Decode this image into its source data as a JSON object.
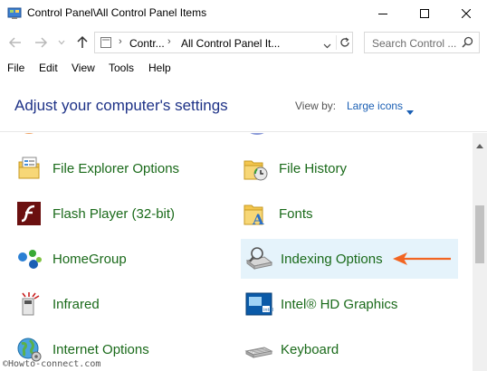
{
  "window": {
    "title": "Control Panel\\All Control Panel Items"
  },
  "address": {
    "crumbs": [
      "Contr...",
      "All Control Panel It..."
    ],
    "search_placeholder": "Search Control ..."
  },
  "menu": [
    "File",
    "Edit",
    "View",
    "Tools",
    "Help"
  ],
  "header": {
    "heading": "Adjust your computer's settings",
    "view_by_label": "View by:",
    "view_by_value": "Large icons"
  },
  "items": [
    {
      "label": "File Explorer Options",
      "icon": "file-explorer-options-icon"
    },
    {
      "label": "File History",
      "icon": "file-history-icon"
    },
    {
      "label": "Flash Player (32-bit)",
      "icon": "flash-player-icon"
    },
    {
      "label": "Fonts",
      "icon": "fonts-icon"
    },
    {
      "label": "HomeGroup",
      "icon": "homegroup-icon"
    },
    {
      "label": "Indexing Options",
      "icon": "indexing-options-icon",
      "selected": true
    },
    {
      "label": "Infrared",
      "icon": "infrared-icon"
    },
    {
      "label": "Intel® HD Graphics",
      "icon": "intel-graphics-icon"
    },
    {
      "label": "Internet Options",
      "icon": "internet-options-icon"
    },
    {
      "label": "Keyboard",
      "icon": "keyboard-icon"
    }
  ],
  "annotation": {
    "arrow_color": "#f26522",
    "points_to": "Indexing Options"
  },
  "watermark": "©Howto-connect.com",
  "colors": {
    "link_green": "#1a6a1a",
    "heading_blue": "#1e3287",
    "highlight": "#e5f3fb"
  }
}
